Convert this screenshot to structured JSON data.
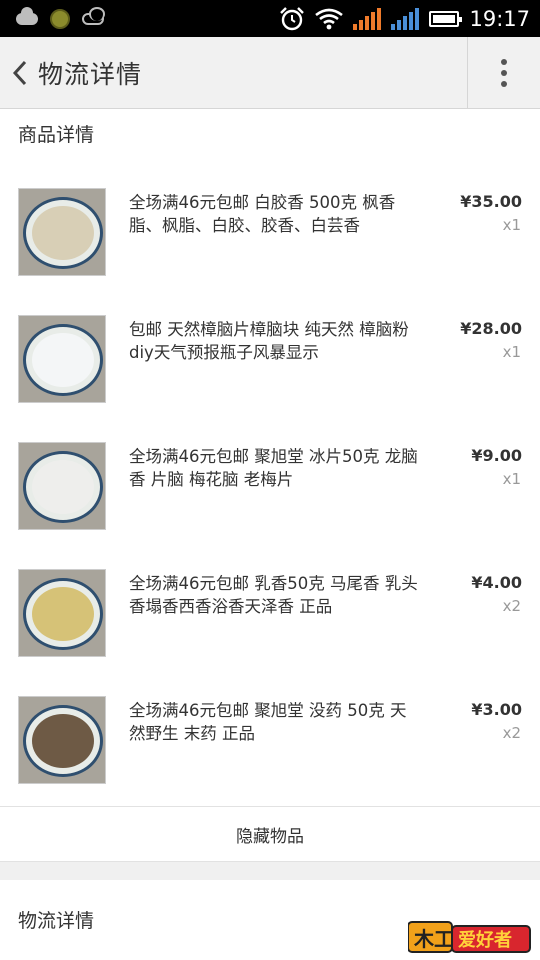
{
  "status_bar": {
    "time": "19:17"
  },
  "header": {
    "title": "物流详情"
  },
  "goods_section": {
    "title": "商品详情"
  },
  "items": [
    {
      "name": "全场满46元包邮 白胶香 500克 枫香脂、枫脂、白胶、胶香、白芸香",
      "price": "¥35.00",
      "qty": "x1",
      "thumb_color": "#d8cfb6"
    },
    {
      "name": "包邮 天然樟脑片樟脑块 纯天然 樟脑粉 diy天气预报瓶子风暴显示",
      "price": "¥28.00",
      "qty": "x1",
      "thumb_color": "#f4f6f7"
    },
    {
      "name": "全场满46元包邮 聚旭堂 冰片50克 龙脑香 片脑 梅花脑 老梅片",
      "price": "¥9.00",
      "qty": "x1",
      "thumb_color": "#eeeeec"
    },
    {
      "name": "全场满46元包邮 乳香50克 马尾香 乳头香塌香西香浴香天泽香 正品",
      "price": "¥4.00",
      "qty": "x2",
      "thumb_color": "#d6c277"
    },
    {
      "name": "全场满46元包邮 聚旭堂 没药 50克 天然野生 末药 正品",
      "price": "¥3.00",
      "qty": "x2",
      "thumb_color": "#6e5a45"
    }
  ],
  "hide_items_label": "隐藏物品",
  "logistics_section": {
    "title": "物流详情"
  },
  "watermark": "爱好者"
}
